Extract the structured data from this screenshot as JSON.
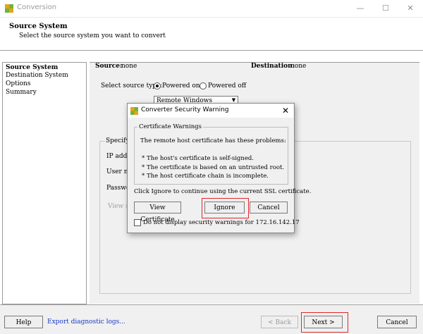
{
  "window": {
    "title": "Conversion",
    "minimize": "—",
    "maximize": "☐",
    "close": "✕"
  },
  "header": {
    "title": "Source System",
    "subtitle": "Select the source system you want to convert"
  },
  "nav": {
    "items": [
      "Source System",
      "Destination System",
      "Options",
      "Summary"
    ]
  },
  "main": {
    "source_label": "Source:",
    "source_value": "none",
    "destination_label": "Destination:",
    "destination_value": "none",
    "source_type_label": "Select source type:",
    "powered_on": "Powered on",
    "powered_off": "Powered off",
    "machine_type": "Remote Windows machine",
    "group_partial": "Specify t",
    "field_ip": "IP addre",
    "field_user": "User nar",
    "field_password": "Passwor",
    "view_source": "View sc"
  },
  "footer": {
    "help": "Help",
    "export_logs": "Export diagnostic logs...",
    "back": "< Back",
    "next": "Next >",
    "cancel": "Cancel"
  },
  "dialog": {
    "title": "Converter Security Warning",
    "group_title": "Certificate Warnings",
    "intro": "The remote host certificate has these problems:",
    "problems": [
      "* The host's certificate is self-signed.",
      "* The certificate is based on an untrusted root.",
      "* The host certificate chain is incomplete."
    ],
    "instruction": "Click Ignore to continue using the current SSL certificate.",
    "view_certificate": "View Certificate",
    "ignore": "Ignore",
    "cancel": "Cancel",
    "checkbox_label": "Do not display security warnings for 172.16.142.17"
  },
  "colors": {
    "highlight": "#e0262a",
    "link": "#1a39c8"
  }
}
